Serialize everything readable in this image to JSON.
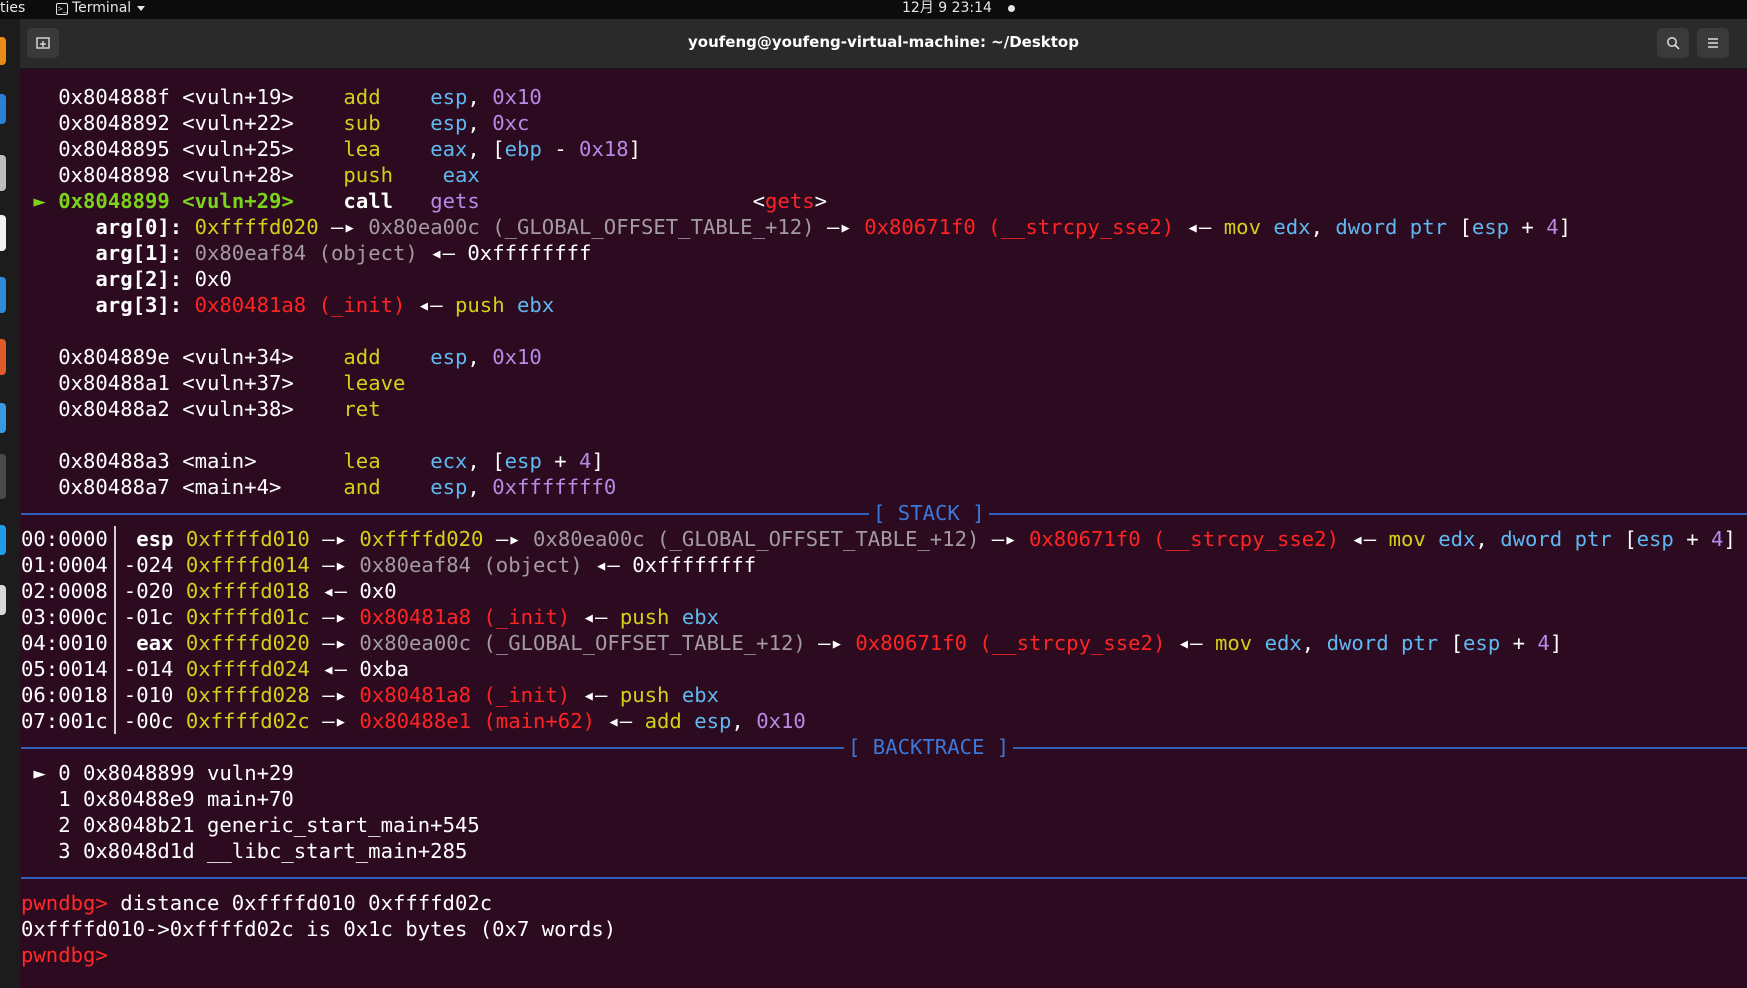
{
  "topbar": {
    "activities": "ties",
    "app_name": "Terminal",
    "clock": "12月 9  23:14"
  },
  "window": {
    "title": "youfeng@youfeng-virtual-machine: ~/Desktop"
  },
  "colors": {
    "background": "#2c0a1f",
    "mnemonic": "#d1d11a",
    "register": "#5fb8f0",
    "immediate": "#b68ae5",
    "code_pointer": "#ff2424",
    "data_pointer": "#a39aa6",
    "current": "#7cd31b",
    "separator": "#3d78d8",
    "prompt": "#ff2a2a"
  },
  "disasm": {
    "rows1": [
      {
        "addr": "0x804888f",
        "sym": "<vuln+19>",
        "op": "add",
        "arg1": "esp",
        "arg2": "0x10"
      },
      {
        "addr": "0x8048892",
        "sym": "<vuln+22>",
        "op": "sub",
        "arg1": "esp",
        "arg2": "0xc"
      },
      {
        "addr": "0x8048895",
        "sym": "<vuln+25>",
        "op": "lea",
        "arg1": "eax",
        "arg2a": "[",
        "arg2b": "ebp",
        "arg2c": " - ",
        "arg2d": "0x18",
        "arg2e": "]"
      },
      {
        "addr": "0x8048898",
        "sym": "<vuln+28>",
        "op": "push",
        "arg1": "eax"
      }
    ],
    "current": {
      "marker": "►",
      "addr": "0x8048899",
      "sym": "<vuln+29>",
      "op": "call",
      "target": "gets",
      "target_sym_l": "<",
      "target_sym": "gets",
      "target_sym_r": ">"
    },
    "args": [
      {
        "name": "arg[0]:",
        "v1": "0xffffd020",
        "v2": "0x80ea00c (_GLOBAL_OFFSET_TABLE_+12)",
        "v3": "0x80671f0 (__strcpy_sse2)",
        "ins": "mov",
        "r1": "edx",
        "k1": "dword",
        "k2": "ptr",
        "br": "[",
        "r2": "esp",
        "pl": " + ",
        "n": "4",
        "br2": "]"
      },
      {
        "name": "arg[1]:",
        "v1": "0x80eaf84 (object)",
        "v2": "0xffffffff"
      },
      {
        "name": "arg[2]:",
        "v1": "0x0"
      },
      {
        "name": "arg[3]:",
        "v1": "0x80481a8 (_init)",
        "ins": "push",
        "r1": "ebx"
      }
    ],
    "rows2": [
      {
        "addr": "0x804889e",
        "sym": "<vuln+34>",
        "op": "add",
        "arg1": "esp",
        "arg2": "0x10"
      },
      {
        "addr": "0x80488a1",
        "sym": "<vuln+37>",
        "op": "leave"
      },
      {
        "addr": "0x80488a2",
        "sym": "<vuln+38>",
        "op": "ret"
      }
    ],
    "rows3": [
      {
        "addr": "0x80488a3",
        "sym": "<main>",
        "op": "lea",
        "arg1": "ecx",
        "br": "[",
        "r2": "esp",
        "pl": " + ",
        "n": "4",
        "br2": "]"
      },
      {
        "addr": "0x80488a7",
        "sym": "<main+4>",
        "op": "and",
        "arg1": "esp",
        "arg2": "0xfffffff0"
      }
    ]
  },
  "stack": {
    "label": "[ STACK ]",
    "rows": [
      {
        "idx": "00:0000",
        "reg": " esp",
        "addr": "0xffffd010",
        "v1": "0xffffd020",
        "v2": "0x80ea00c (_GLOBAL_OFFSET_TABLE_+12)",
        "v3": "0x80671f0 (__strcpy_sse2)",
        "ins": "mov",
        "r1": "edx",
        "k1": "dword",
        "k2": "ptr",
        "br": "[",
        "r2": "esp",
        "pl": " + ",
        "n": "4",
        "br2": "]"
      },
      {
        "idx": "01:0004",
        "reg": "-024",
        "addr": "0xffffd014",
        "v1": "0x80eaf84 (object)",
        "v2": "0xffffffff"
      },
      {
        "idx": "02:0008",
        "reg": "-020",
        "addr": "0xffffd018",
        "v1": "0x0"
      },
      {
        "idx": "03:000c",
        "reg": "-01c",
        "addr": "0xffffd01c",
        "v1": "0x80481a8 (_init)",
        "ins": "push",
        "r1": "ebx"
      },
      {
        "idx": "04:0010",
        "reg": " eax",
        "addr": "0xffffd020",
        "v1": "0x80ea00c (_GLOBAL_OFFSET_TABLE_+12)",
        "v2": "0x80671f0 (__strcpy_sse2)",
        "ins": "mov",
        "r1": "edx",
        "k1": "dword",
        "k2": "ptr",
        "br": "[",
        "r2": "esp",
        "pl": " + ",
        "n": "4",
        "br2": "]"
      },
      {
        "idx": "05:0014",
        "reg": "-014",
        "addr": "0xffffd024",
        "v1": "0xba"
      },
      {
        "idx": "06:0018",
        "reg": "-010",
        "addr": "0xffffd028",
        "v1": "0x80481a8 (_init)",
        "ins": "push",
        "r1": "ebx"
      },
      {
        "idx": "07:001c",
        "reg": "-00c",
        "addr": "0xffffd02c",
        "v1": "0x80488e1 (main+62)",
        "ins": "add",
        "r1": "esp",
        "n": "0x10"
      }
    ]
  },
  "backtrace": {
    "label": "[ BACKTRACE ]",
    "rows": [
      {
        "marker": "►",
        "text": " 0 0x8048899 vuln+29"
      },
      {
        "marker": " ",
        "text": " 1 0x80488e9 main+70"
      },
      {
        "marker": " ",
        "text": " 2 0x8048b21 generic_start_main+545"
      },
      {
        "marker": " ",
        "text": " 3 0x8048d1d __libc_start_main+285"
      }
    ]
  },
  "console": {
    "prompt": "pwndbg>",
    "command": " distance 0xffffd010 0xffffd02c",
    "output": "0xffffd010->0xffffd02c is 0x1c bytes (0x7 words)",
    "prompt2": "pwndbg>"
  }
}
